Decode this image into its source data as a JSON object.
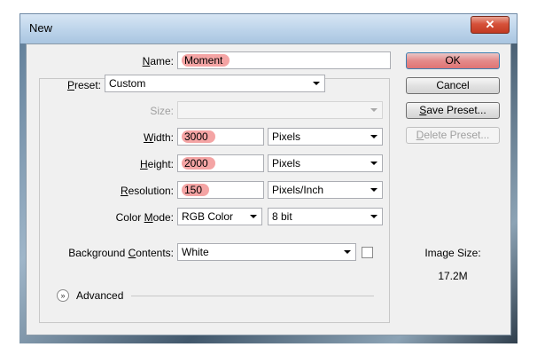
{
  "window": {
    "title": "New",
    "close_glyph": "✕"
  },
  "form": {
    "name": {
      "label": "Name:",
      "u": "N",
      "rest": "ame:",
      "value": "Moment"
    },
    "preset": {
      "u": "P",
      "rest": "reset:",
      "value": "Custom"
    },
    "size": {
      "label": "Size:",
      "value": ""
    },
    "width": {
      "u": "W",
      "rest": "idth:",
      "value": "3000",
      "unit": "Pixels"
    },
    "height": {
      "u": "H",
      "rest": "eight:",
      "value": "2000",
      "unit": "Pixels"
    },
    "resolution": {
      "u": "R",
      "rest": "esolution:",
      "value": "150",
      "unit": "Pixels/Inch"
    },
    "color_mode": {
      "pre": "Color ",
      "u": "M",
      "rest": "ode:",
      "mode": "RGB Color",
      "bits": "8 bit"
    },
    "background": {
      "pre": "Background ",
      "u": "C",
      "rest": "ontents:",
      "value": "White"
    },
    "advanced": {
      "label": "Advanced",
      "icon": "chevron-double-down-icon"
    }
  },
  "buttons": {
    "ok": "OK",
    "cancel": "Cancel",
    "save_preset": {
      "u": "S",
      "rest": "ave Preset..."
    },
    "delete_preset": {
      "u": "D",
      "rest": "elete Preset..."
    }
  },
  "image_size": {
    "label": "Image Size:",
    "value": "17.2M"
  },
  "colors": {
    "titlebar": "#bcd3ea",
    "close": "#c23a22",
    "highlight": "#eb5a5a",
    "ok": "#df7474"
  }
}
